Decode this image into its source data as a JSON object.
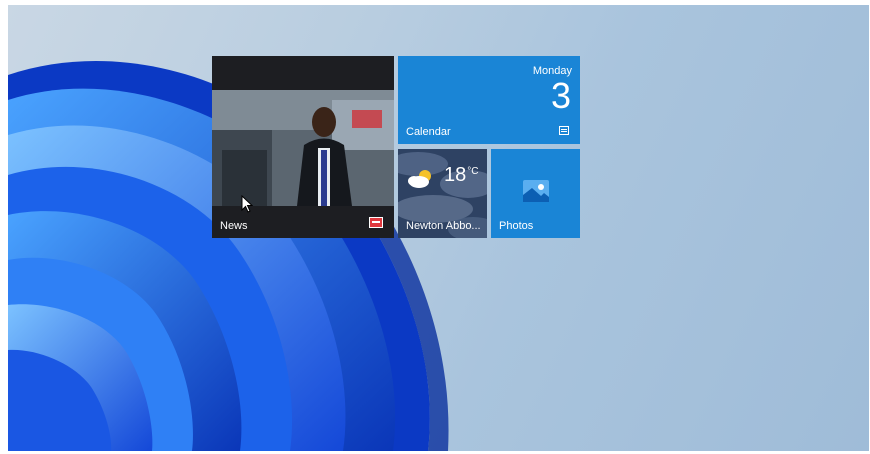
{
  "start_tiles": {
    "news": {
      "label": "News",
      "icon": "news-badge-icon"
    },
    "calendar": {
      "label": "Calendar",
      "day": "Monday",
      "date": "3",
      "icon": "calendar-icon"
    },
    "weather": {
      "label": "Newton Abbo...",
      "temperature": "18",
      "unit": "°C",
      "icon": "partly-cloudy-icon"
    },
    "photos": {
      "label": "Photos",
      "icon": "photos-icon"
    }
  },
  "colors": {
    "tile_blue": "#1a85d6",
    "news_background": "#1d1e22",
    "wallpaper_blue": "#1a5fe0",
    "desktop_background": "#b8cde0"
  }
}
